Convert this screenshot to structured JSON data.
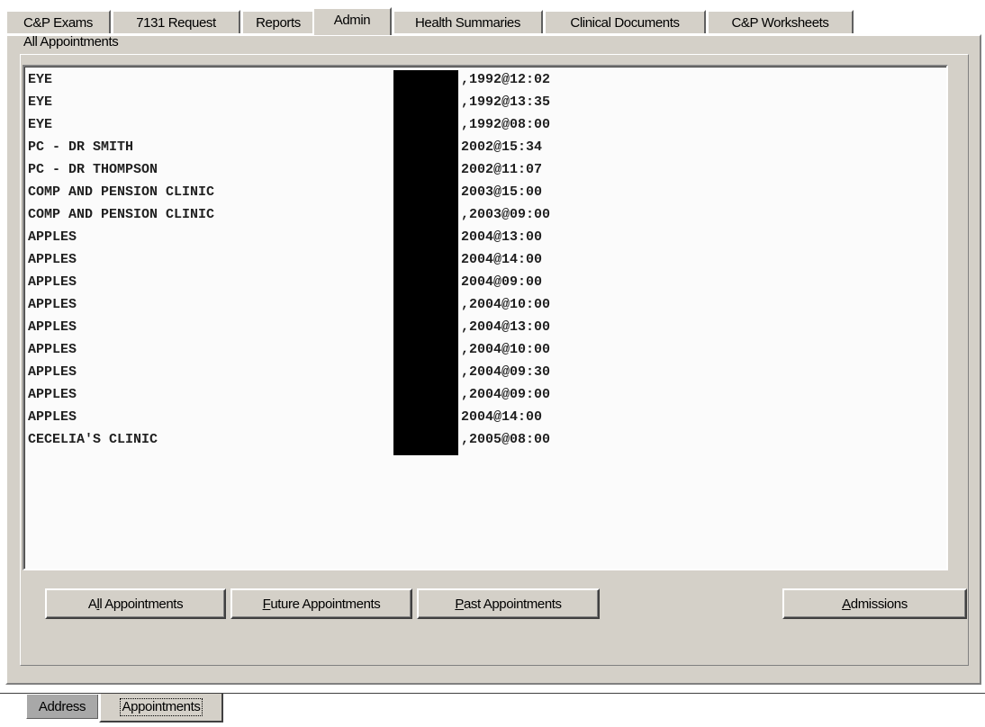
{
  "top_tabs": [
    {
      "label": "C&P Exams"
    },
    {
      "label": "7131 Request"
    },
    {
      "label": "Reports"
    },
    {
      "label": "Admin",
      "active": true
    },
    {
      "label": "Health Summaries"
    },
    {
      "label": "Clinical Documents"
    },
    {
      "label": "C&P Worksheets"
    }
  ],
  "list": {
    "heading": "All Appointments",
    "rows": [
      {
        "clinic": "EYE",
        "when": ",1992@12:02"
      },
      {
        "clinic": "EYE",
        "when": ",1992@13:35"
      },
      {
        "clinic": "EYE",
        "when": ",1992@08:00"
      },
      {
        "clinic": "PC - DR SMITH",
        "when": "2002@15:34"
      },
      {
        "clinic": "PC - DR THOMPSON",
        "when": "2002@11:07"
      },
      {
        "clinic": "COMP AND PENSION CLINIC",
        "when": "2003@15:00"
      },
      {
        "clinic": "COMP AND PENSION CLINIC",
        "when": ",2003@09:00"
      },
      {
        "clinic": "APPLES",
        "when": "2004@13:00"
      },
      {
        "clinic": "APPLES",
        "when": "2004@14:00"
      },
      {
        "clinic": "APPLES",
        "when": "2004@09:00"
      },
      {
        "clinic": "APPLES",
        "when": ",2004@10:00"
      },
      {
        "clinic": "APPLES",
        "when": ",2004@13:00"
      },
      {
        "clinic": "APPLES",
        "when": ",2004@10:00"
      },
      {
        "clinic": "APPLES",
        "when": ",2004@09:30"
      },
      {
        "clinic": "APPLES",
        "when": ",2004@09:00"
      },
      {
        "clinic": "APPLES",
        "when": "2004@14:00"
      },
      {
        "clinic": "CECELIA'S CLINIC",
        "when": ",2005@08:00"
      }
    ]
  },
  "buttons": {
    "all": {
      "label": "All Appointments",
      "mnemonic": "l"
    },
    "future": {
      "label": "Future Appointments",
      "mnemonic": "F"
    },
    "past": {
      "label": "Past Appointments",
      "mnemonic": "P"
    },
    "admissions": {
      "label": "Admissions",
      "mnemonic": "A"
    }
  },
  "bottom_tabs": [
    {
      "label": "Address"
    },
    {
      "label": "Appointments",
      "active": true
    }
  ],
  "colors": {
    "face": "#d4d0c8",
    "list_background": "#fbfbfb",
    "redaction": "#000000"
  }
}
